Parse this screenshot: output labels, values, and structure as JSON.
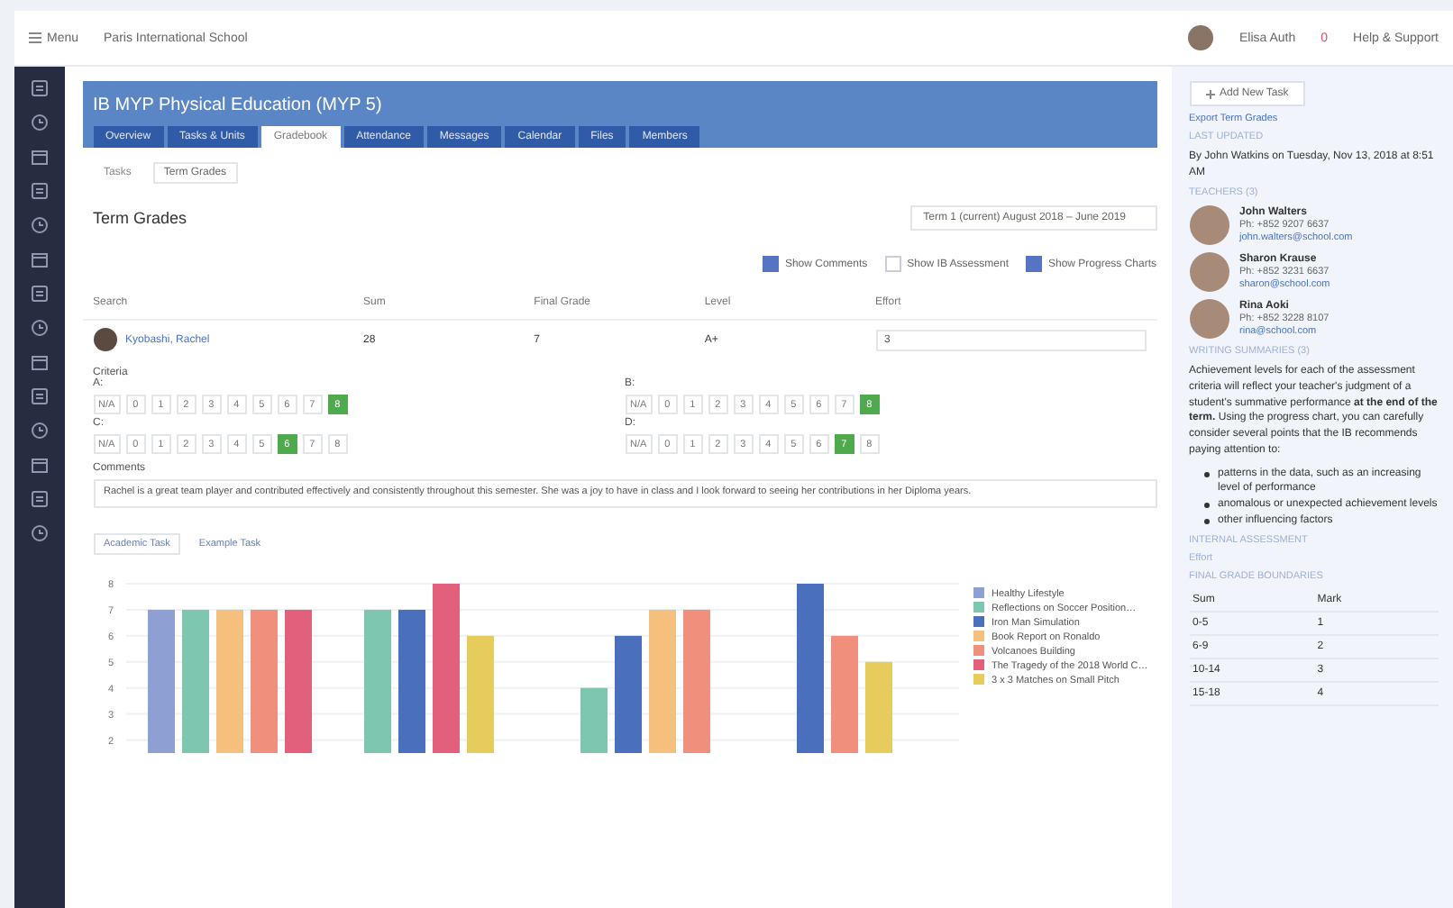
{
  "top_bar": {
    "menu": "Menu",
    "school": "Paris International School",
    "user": "Elisa Auth",
    "notifications": "0",
    "help": "Help & Support"
  },
  "class": {
    "title": "IB MYP Physical Education (MYP 5)",
    "tabs": [
      {
        "label": "Overview",
        "selected": false
      },
      {
        "label": "Tasks & Units",
        "selected": false
      },
      {
        "label": "Gradebook",
        "selected": true
      },
      {
        "label": "Attendance",
        "selected": false
      },
      {
        "label": "Messages",
        "selected": false
      },
      {
        "label": "Calendar",
        "selected": false
      },
      {
        "label": "Files",
        "selected": false
      },
      {
        "label": "Members",
        "selected": false
      }
    ]
  },
  "subtabs": [
    {
      "label": "Tasks",
      "selected": false
    },
    {
      "label": "Term Grades",
      "selected": true
    }
  ],
  "heading": "Term Grades",
  "term_select": "Term 1 (current) August 2018 – June 2019",
  "options": [
    {
      "label": "Show Comments",
      "checked": true
    },
    {
      "label": "Show IB Assessment",
      "checked": false
    },
    {
      "label": "Show Progress Charts",
      "checked": true
    }
  ],
  "table": {
    "search_placeholder": "Search",
    "columns": [
      "Sum",
      "Final Grade",
      "Level",
      "Effort"
    ],
    "row": {
      "student": "Kyobashi, Rachel",
      "sum": "28",
      "final_grade": "7",
      "level": "A+",
      "effort": "3"
    }
  },
  "criteria_label": "Criteria",
  "criteria": [
    {
      "label": "A:",
      "options": [
        {
          "label": "N/A",
          "selected": false
        },
        {
          "label": "0",
          "selected": false
        },
        {
          "label": "1",
          "selected": false
        },
        {
          "label": "2",
          "selected": false
        },
        {
          "label": "3",
          "selected": false
        },
        {
          "label": "4",
          "selected": false
        },
        {
          "label": "5",
          "selected": false
        },
        {
          "label": "6",
          "selected": false
        },
        {
          "label": "7",
          "selected": false
        },
        {
          "label": "8",
          "selected": true
        }
      ]
    },
    {
      "label": "B:",
      "options": [
        {
          "label": "N/A",
          "selected": false
        },
        {
          "label": "0",
          "selected": false
        },
        {
          "label": "1",
          "selected": false
        },
        {
          "label": "2",
          "selected": false
        },
        {
          "label": "3",
          "selected": false
        },
        {
          "label": "4",
          "selected": false
        },
        {
          "label": "5",
          "selected": false
        },
        {
          "label": "6",
          "selected": false
        },
        {
          "label": "7",
          "selected": false
        },
        {
          "label": "8",
          "selected": true
        }
      ]
    },
    {
      "label": "C:",
      "options": [
        {
          "label": "N/A",
          "selected": false
        },
        {
          "label": "0",
          "selected": false
        },
        {
          "label": "1",
          "selected": false
        },
        {
          "label": "2",
          "selected": false
        },
        {
          "label": "3",
          "selected": false
        },
        {
          "label": "4",
          "selected": false
        },
        {
          "label": "5",
          "selected": false
        },
        {
          "label": "6",
          "selected": true
        },
        {
          "label": "7",
          "selected": false
        },
        {
          "label": "8",
          "selected": false
        }
      ]
    },
    {
      "label": "D:",
      "options": [
        {
          "label": "N/A",
          "selected": false
        },
        {
          "label": "0",
          "selected": false
        },
        {
          "label": "1",
          "selected": false
        },
        {
          "label": "2",
          "selected": false
        },
        {
          "label": "3",
          "selected": false
        },
        {
          "label": "4",
          "selected": false
        },
        {
          "label": "5",
          "selected": false
        },
        {
          "label": "6",
          "selected": false
        },
        {
          "label": "7",
          "selected": true
        },
        {
          "label": "8",
          "selected": false
        }
      ]
    }
  ],
  "comments_label": "Comments",
  "comment": "Rachel is a great team player and contributed effectively and consistently throughout this semester. She was a joy to have in class and I look forward to seeing her contributions in her Diploma years.",
  "chart_tabs": [
    {
      "label": "Academic Task",
      "selected": true
    },
    {
      "label": "Example Task",
      "selected": false
    }
  ],
  "chart": {
    "chart_data": {
      "type": "bar",
      "grid": true,
      "legend": "right",
      "ylim": [
        1.5,
        8
      ],
      "yticks": [
        2,
        3,
        4,
        5,
        6,
        7,
        8
      ],
      "series": [
        {
          "name": "Healthy Lifestyle",
          "color": "#8e9fd3",
          "values": [
            7,
            null,
            null,
            null
          ]
        },
        {
          "name": "Reflections on Soccer Position…",
          "color": "#7fc6b1",
          "values": [
            7,
            7,
            4,
            null
          ]
        },
        {
          "name": "Iron Man Simulation",
          "color": "#4a6fbd",
          "values": [
            null,
            7,
            6,
            8
          ]
        },
        {
          "name": "Book Report on Ronaldo",
          "color": "#f5c07e",
          "values": [
            7,
            null,
            7,
            null
          ]
        },
        {
          "name": "Volcanoes Building",
          "color": "#f08f7b",
          "values": [
            7,
            null,
            7,
            6
          ]
        },
        {
          "name": "The Tragedy of the 2018 World C…",
          "color": "#e2607b",
          "values": [
            7,
            8,
            null,
            null
          ]
        },
        {
          "name": "3 x 3 Matches on Small Pitch",
          "color": "#e6cc5c",
          "values": [
            null,
            6,
            null,
            5
          ]
        }
      ]
    }
  },
  "right_panel": {
    "add_button": "Add New Task",
    "export_link": "Export Term Grades",
    "updated_label": "LAST UPDATED",
    "updated_text": "By John Watkins on Tuesday, Nov 13, 2018 at 8:51 AM",
    "teachers_label": "TEACHERS (3)",
    "teachers": [
      {
        "name": "John Walters",
        "phone": "Ph: +852 9207 6637",
        "email": "john.walters@school.com"
      },
      {
        "name": "Sharon Krause",
        "phone": "Ph: +852 3231 6637",
        "email": "sharon@school.com"
      },
      {
        "name": "Rina Aoki",
        "phone": "Ph: +852 3228 8107",
        "email": "rina@school.com"
      }
    ],
    "summary_label": "WRITING SUMMARIES (3)",
    "summary": "Achievement levels for each of the assessment criteria will reflect your teacher's judgment of a student's summative performance **at the end of the term.** Using the progress chart, you can carefully consider several points that the IB recommends paying attention to:",
    "bullets": [
      "patterns in the data, such as an increasing level of performance",
      "anomalous or unexpected achievement levels",
      "other influencing factors"
    ],
    "internal_label": "INTERNAL ASSESSMENT",
    "effort_label": "Effort",
    "boundaries_label": "FINAL GRADE BOUNDARIES",
    "boundaries": {
      "columns": [
        "Sum",
        "Mark"
      ],
      "rows": [
        [
          "0-5",
          "1"
        ],
        [
          "6-9",
          "2"
        ],
        [
          "10-14",
          "3"
        ],
        [
          "15-18",
          "4"
        ]
      ]
    }
  }
}
